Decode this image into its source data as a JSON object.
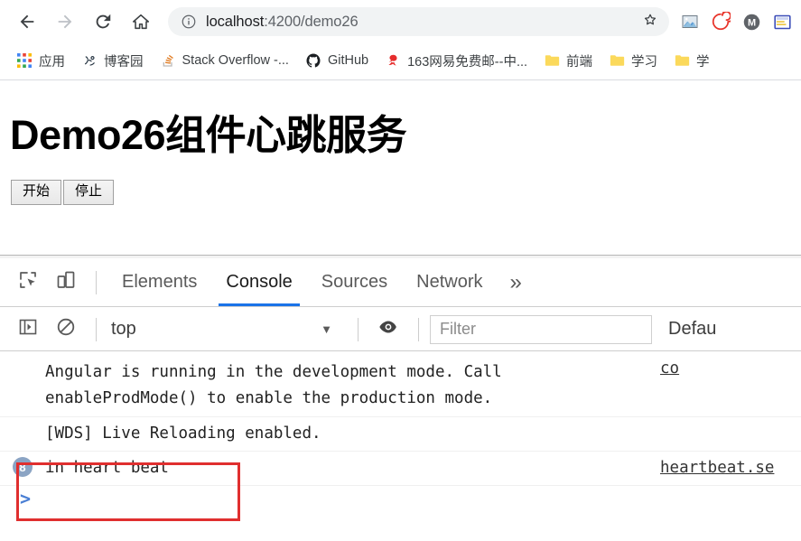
{
  "browser": {
    "nav": {
      "back_title": "Back",
      "forward_title": "Forward",
      "reload_title": "Reload",
      "home_title": "Home"
    },
    "omnibox": {
      "site_info_icon": "info-circle-icon",
      "url_host": "localhost",
      "url_rest": ":4200/demo26",
      "url_full": "localhost:4200/demo26",
      "star_icon": "star-icon"
    },
    "extensions": [
      {
        "name": "screenshot-extension-icon",
        "icon": "image-icon",
        "color": "#7ea9c9"
      },
      {
        "name": "spiral-extension-icon",
        "icon": "spiral-icon",
        "color": "#e8342a"
      },
      {
        "name": "m-extension-icon",
        "icon": "letter-m-icon",
        "color": "#5f6368",
        "letter": "M"
      },
      {
        "name": "form-extension-icon",
        "icon": "form-icon",
        "color": "#3b4cb8"
      }
    ],
    "bookmarks": [
      {
        "label": "应用",
        "icon": "apps-grid-icon",
        "type": "apps"
      },
      {
        "label": "博客园",
        "icon": "cnblogs-icon",
        "type": "site"
      },
      {
        "label": "Stack Overflow -...",
        "icon": "stackoverflow-icon",
        "type": "site"
      },
      {
        "label": "GitHub",
        "icon": "github-icon",
        "type": "site"
      },
      {
        "label": "163网易免费邮--中...",
        "icon": "netease-mail-icon",
        "type": "site"
      },
      {
        "label": "前端",
        "icon": "folder-icon",
        "type": "folder"
      },
      {
        "label": "学习",
        "icon": "folder-icon",
        "type": "folder"
      },
      {
        "label": "学",
        "icon": "folder-icon",
        "type": "folder"
      }
    ]
  },
  "page": {
    "title": "Demo26组件心跳服务",
    "buttons": {
      "start": "开始",
      "stop": "停止"
    }
  },
  "devtools": {
    "tools": {
      "inspect_icon": "inspect-element-icon",
      "device_icon": "device-toolbar-icon"
    },
    "tabs": [
      {
        "label": "Elements",
        "active": false
      },
      {
        "label": "Console",
        "active": true
      },
      {
        "label": "Sources",
        "active": false
      },
      {
        "label": "Network",
        "active": false
      }
    ],
    "more_tabs": "»",
    "console_toolbar": {
      "sidebar_icon": "console-sidebar-icon",
      "clear_icon": "clear-console-icon",
      "context": "top",
      "context_caret": "▼",
      "eye_icon": "live-expression-eye-icon",
      "filter_placeholder": "Filter",
      "filter_value": "",
      "levels": "Defau"
    },
    "messages": [
      {
        "id": "angular",
        "text": "Angular is running in the development mode. Call\nenableProdMode() to enable the production mode.",
        "source": "co",
        "badge": null
      },
      {
        "id": "wds",
        "text": "[WDS] Live Reloading enabled.",
        "source": "",
        "badge": null
      },
      {
        "id": "heartbeat",
        "text": "in heart beat",
        "source": "heartbeat.se",
        "badge": "8"
      }
    ],
    "prompt": ">"
  },
  "annotation": {
    "color": "#e02f2f",
    "target": "in heart beat"
  }
}
